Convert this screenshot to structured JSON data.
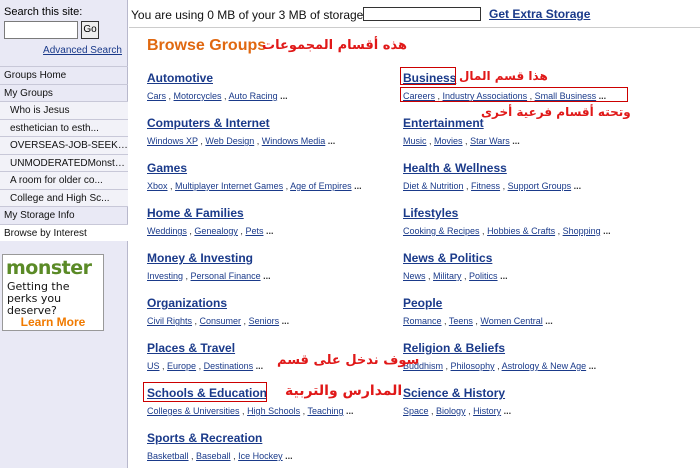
{
  "sidebar": {
    "search_label": "Search this site:",
    "go_label": "Go",
    "advanced_search": "Advanced Search",
    "nav": [
      {
        "label": "Groups Home",
        "level": 0
      },
      {
        "label": "My Groups",
        "level": 0
      },
      {
        "label": "Who is Jesus",
        "level": 1
      },
      {
        "label": "esthetician to esth...",
        "level": 1
      },
      {
        "label": "OVERSEAS-JOB-SEEKER...",
        "level": 1
      },
      {
        "label": "UNMODERATEDMonsters...",
        "level": 1
      },
      {
        "label": "A room for older co...",
        "level": 1
      },
      {
        "label": "College and High Sc...",
        "level": 1
      },
      {
        "label": "My Storage Info",
        "level": 0
      },
      {
        "label": "Browse by Interest",
        "level": 0,
        "active": true
      }
    ],
    "ad": {
      "logo": "monster",
      "tagline": "Getting the perks you deserve?",
      "button": "Learn More"
    }
  },
  "top": {
    "storage_text": "You are using 0 MB of your 3 MB of storage:",
    "extra_storage": "Get Extra Storage"
  },
  "main": {
    "title": "Browse Groups",
    "left_column": [
      {
        "title": "Automotive",
        "subs": [
          "Cars",
          "Motorcycles",
          "Auto Racing"
        ]
      },
      {
        "title": "Computers & Internet",
        "subs": [
          "Windows XP",
          "Web Design",
          "Windows Media"
        ]
      },
      {
        "title": "Games",
        "subs": [
          "Xbox",
          "Multiplayer Internet Games",
          "Age of Empires"
        ]
      },
      {
        "title": "Home & Families",
        "subs": [
          "Weddings",
          "Genealogy",
          "Pets"
        ]
      },
      {
        "title": "Money & Investing",
        "subs": [
          "Investing",
          "Personal Finance"
        ]
      },
      {
        "title": "Organizations",
        "subs": [
          "Civil Rights",
          "Consumer",
          "Seniors"
        ]
      },
      {
        "title": "Places & Travel",
        "subs": [
          "US",
          "Europe",
          "Destinations"
        ]
      },
      {
        "title": "Schools & Education",
        "subs": [
          "Colleges & Universities",
          "High Schools",
          "Teaching"
        ]
      },
      {
        "title": "Sports & Recreation",
        "subs": [
          "Basketball",
          "Baseball",
          "Ice Hockey"
        ]
      }
    ],
    "right_column": [
      {
        "title": "Business",
        "subs": [
          "Careers",
          "Industry Associations",
          "Small Business"
        ]
      },
      {
        "title": "Entertainment",
        "subs": [
          "Music",
          "Movies",
          "Star Wars"
        ]
      },
      {
        "title": "Health & Wellness",
        "subs": [
          "Diet & Nutrition",
          "Fitness",
          "Support Groups"
        ]
      },
      {
        "title": "Lifestyles",
        "subs": [
          "Cooking & Recipes",
          "Hobbies & Crafts",
          "Shopping"
        ]
      },
      {
        "title": "News & Politics",
        "subs": [
          "News",
          "Military",
          "Politics"
        ]
      },
      {
        "title": "People",
        "subs": [
          "Romance",
          "Teens",
          "Women Central"
        ]
      },
      {
        "title": "Religion & Beliefs",
        "subs": [
          "Buddhism",
          "Philosophy",
          "Astrology & New Age"
        ]
      },
      {
        "title": "Science & History",
        "subs": [
          "Space",
          "Biology",
          "History"
        ]
      }
    ],
    "more": "..."
  },
  "annotations": {
    "groups": "هذه أقسام المجموعات",
    "business": "هذا قسم المال",
    "sub_sections": "وتحته أقسام فرعية أخرى",
    "will_enter": "سوف ندخل على قسم",
    "schools": "المدارس والتربية"
  },
  "colors": {
    "title": "#e06810",
    "link": "#1a3a8a",
    "annotation": "#e01818",
    "sidebar_bg": "#e9e9f5"
  }
}
